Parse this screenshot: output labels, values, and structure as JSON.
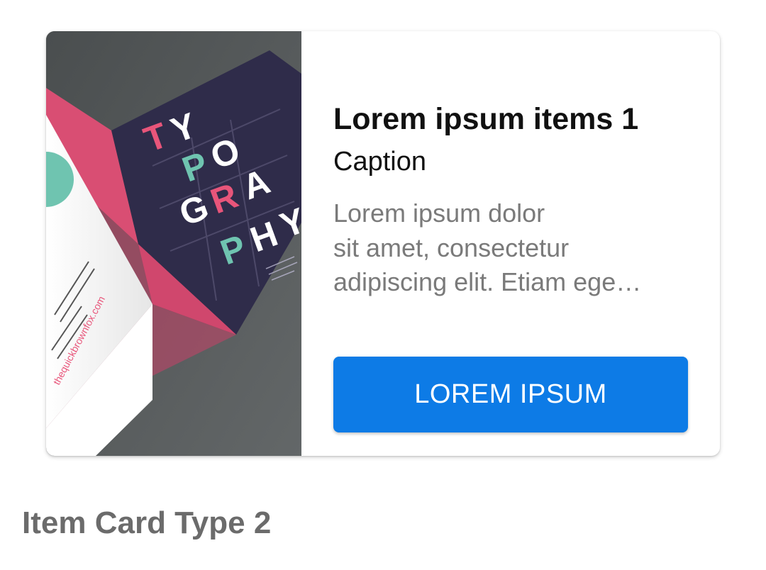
{
  "card": {
    "title": "Lorem ipsum items 1",
    "caption": "Caption",
    "description_lines": [
      "Lorem ipsum dolor",
      "sit amet, consectetur",
      "adipiscing elit. Etiam ege…"
    ],
    "button_label": "LOREM IPSUM",
    "image": {
      "poster_letters": [
        "T",
        "Y",
        "P",
        "O",
        "G",
        "R",
        "A",
        "P",
        "H",
        "Y"
      ],
      "url_text": "thequickbrownfox.com",
      "colors": {
        "background": "#55595a",
        "navy_panel": "#2f2c4a",
        "pink_panel": "#d94e73",
        "teal": "#6fc4b0",
        "pink_accent": "#e8557a"
      }
    }
  },
  "section_label": "Item Card Type 2",
  "colors": {
    "button": "#0d7be6",
    "title": "#111111",
    "description": "#7a7a7a",
    "section_label": "#6b6b6b"
  }
}
